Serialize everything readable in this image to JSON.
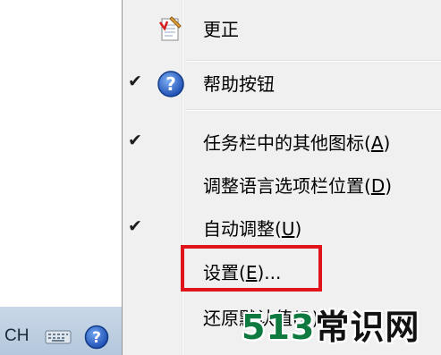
{
  "menu": {
    "items": [
      {
        "label": "更正",
        "mnemonic": "",
        "checked": false,
        "icon": "edit-note-icon"
      },
      {
        "label": "帮助按钮",
        "mnemonic": "",
        "checked": true,
        "icon": "help-icon"
      },
      {
        "label_pre": "任务栏中的其他图标(",
        "mnemonic": "A",
        "label_post": ")",
        "checked": true
      },
      {
        "label_pre": "调整语言选项栏位置(",
        "mnemonic": "D",
        "label_post": ")",
        "checked": false
      },
      {
        "label_pre": "自动调整(",
        "mnemonic": "U",
        "label_post": ")",
        "checked": true
      },
      {
        "label_pre": "设置(",
        "mnemonic": "E",
        "label_post": ")...",
        "checked": false
      },
      {
        "label_pre": "还原默认值(",
        "mnemonic": "R",
        "label_post": ")",
        "checked": false
      }
    ],
    "check_glyph": "✔"
  },
  "taskbar": {
    "language": "CH",
    "icons": [
      "keyboard-icon",
      "help-icon",
      "options-arrow-icon",
      "show-hidden-icons-icon"
    ]
  },
  "watermark": {
    "number": "513",
    "text": "常识网"
  },
  "colors": {
    "highlight": "#e2141b",
    "menu_bg": "#f0f0f0",
    "help_blue": "#1f4fb3",
    "watermark_green": "#0f7a3f"
  }
}
